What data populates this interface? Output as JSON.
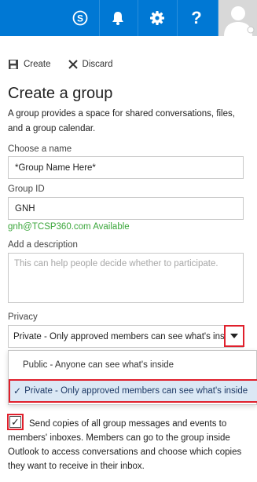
{
  "topbar": {
    "background": "#0078d4",
    "icons": [
      "skype-icon",
      "bell-icon",
      "gear-icon",
      "help-icon",
      "avatar"
    ],
    "help_label": "?"
  },
  "toolbar": {
    "create_label": "Create",
    "discard_label": "Discard"
  },
  "page": {
    "title": "Create a group",
    "description": "A group provides a space for shared conversations, files, and a group calendar."
  },
  "form": {
    "name_label": "Choose a name",
    "name_value": "*Group Name Here*",
    "group_id_label": "Group ID",
    "group_id_value": "GNH",
    "availability_text": "gnh@TCSP360.com  Available",
    "description_label": "Add a description",
    "description_placeholder": "This can help people decide whether to participate.",
    "privacy_label": "Privacy",
    "privacy_value": "Private - Only approved members can see what's inside",
    "privacy_options": [
      {
        "label": "Public - Anyone can see what's inside",
        "selected": false
      },
      {
        "label": "Private - Only approved members can see what's inside",
        "selected": true
      }
    ],
    "checkmark": "✓",
    "send_copies_checked": true,
    "send_copies_text": "Send copies of all group messages and events to members' inboxes. Members can go to the group inside Outlook to access conversations and choose which copies they want to receive in their inbox."
  },
  "colors": {
    "accent": "#0078d4",
    "available_green": "#3aa63a",
    "highlight_red": "#e0202c",
    "selected_option_bg": "#dbe8f5"
  }
}
